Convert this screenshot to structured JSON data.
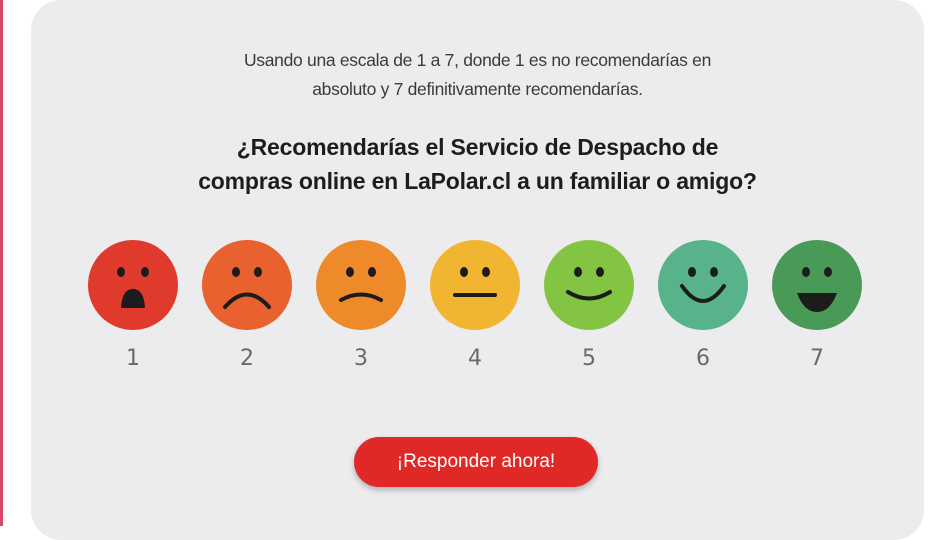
{
  "survey": {
    "intro_line1": "Usando una escala de 1 a 7, donde 1 es no recomendarías en",
    "intro_line2": "absoluto y 7 definitivamente recomendarías.",
    "question_line1": "¿Recomendarías el Servicio de Despacho de",
    "question_line2": "compras online en LaPolar.cl a un familiar o amigo?",
    "options": [
      {
        "label": "1",
        "color": "#e03a2c",
        "icon": "very-unhappy-face-icon"
      },
      {
        "label": "2",
        "color": "#e9612f",
        "icon": "unhappy-face-icon"
      },
      {
        "label": "3",
        "color": "#ef8a2a",
        "icon": "slightly-unhappy-face-icon"
      },
      {
        "label": "4",
        "color": "#f2b532",
        "icon": "neutral-face-icon"
      },
      {
        "label": "5",
        "color": "#84c443",
        "icon": "slightly-happy-face-icon"
      },
      {
        "label": "6",
        "color": "#58b38a",
        "icon": "happy-face-icon"
      },
      {
        "label": "7",
        "color": "#4a9a57",
        "icon": "very-happy-face-icon"
      }
    ],
    "cta_label": "¡Responder ahora!",
    "cta_color": "#e02827"
  }
}
